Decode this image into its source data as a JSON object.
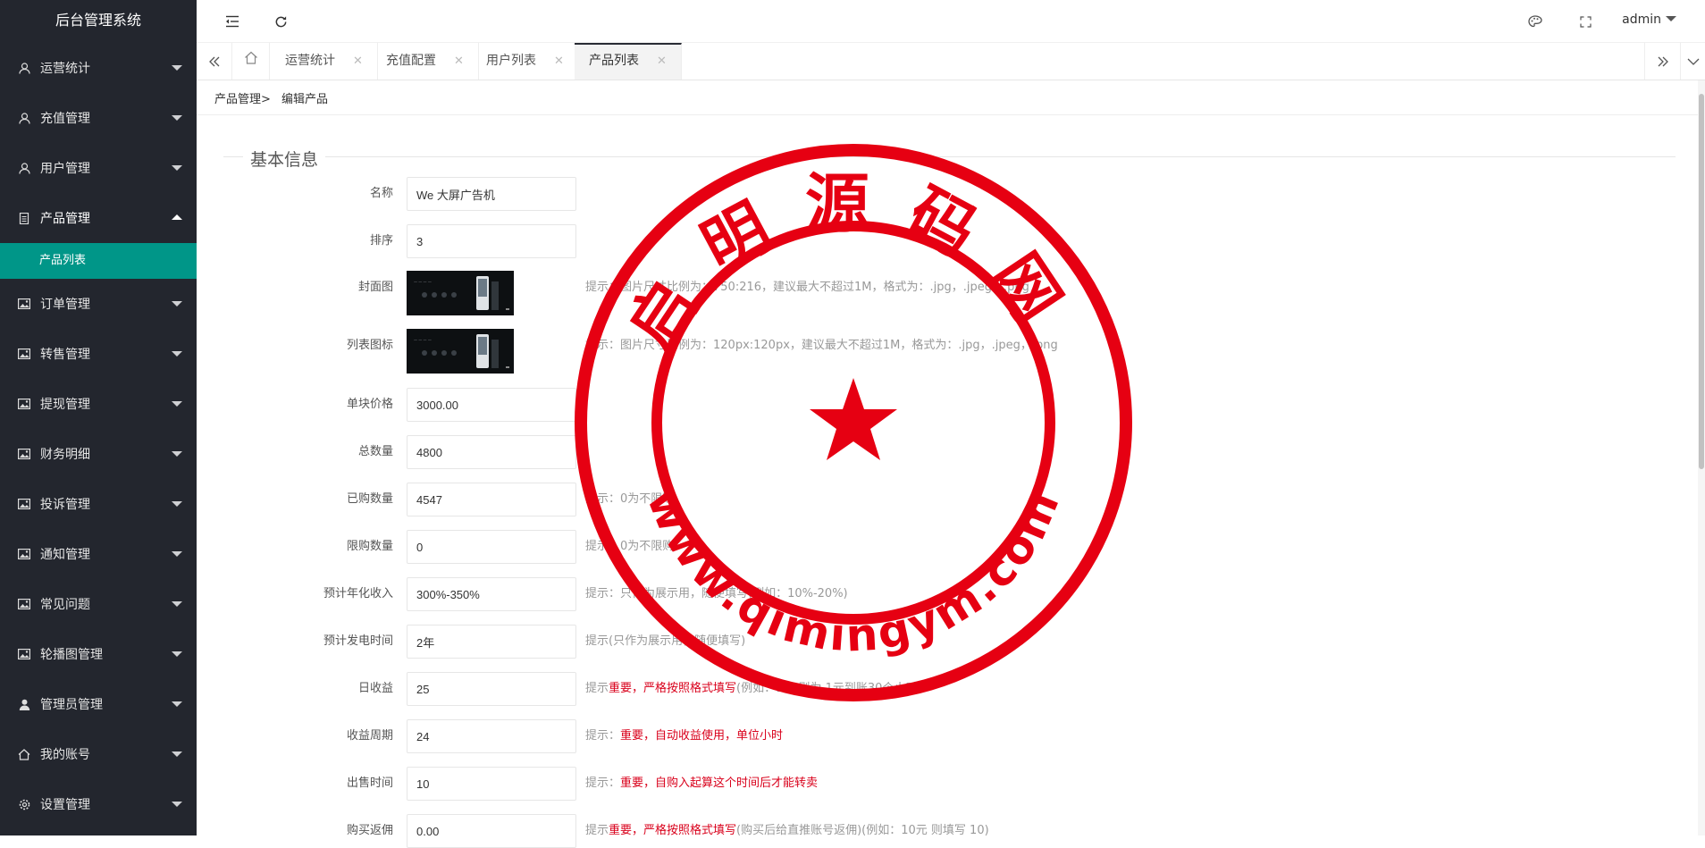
{
  "app": {
    "title": "后台管理系统"
  },
  "sidebar": {
    "items": [
      {
        "label": "运营统计",
        "icon": "user-icon"
      },
      {
        "label": "充值管理",
        "icon": "user-icon"
      },
      {
        "label": "用户管理",
        "icon": "user-icon"
      },
      {
        "label": "产品管理",
        "icon": "document-icon",
        "expanded": true,
        "children": [
          {
            "label": "产品列表",
            "active": true
          }
        ]
      },
      {
        "label": "订单管理",
        "icon": "image-icon"
      },
      {
        "label": "转售管理",
        "icon": "image-icon"
      },
      {
        "label": "提现管理",
        "icon": "image-icon"
      },
      {
        "label": "财务明细",
        "icon": "image-icon"
      },
      {
        "label": "投诉管理",
        "icon": "image-icon"
      },
      {
        "label": "通知管理",
        "icon": "image-icon"
      },
      {
        "label": "常见问题",
        "icon": "image-icon"
      },
      {
        "label": "轮播图管理",
        "icon": "image-icon"
      },
      {
        "label": "管理员管理",
        "icon": "person-icon"
      },
      {
        "label": "我的账号",
        "icon": "home-icon"
      },
      {
        "label": "设置管理",
        "icon": "gear-icon"
      }
    ]
  },
  "header": {
    "user": "admin"
  },
  "tabs": [
    {
      "label": "运营统计"
    },
    {
      "label": "充值配置"
    },
    {
      "label": "用户列表"
    },
    {
      "label": "产品列表",
      "active": true
    }
  ],
  "breadcrumb": {
    "parent": "产品管理>",
    "current": "编辑产品"
  },
  "form": {
    "legend": "基本信息",
    "fields": [
      {
        "label": "名称",
        "value": "We 大屏广告机"
      },
      {
        "label": "排序",
        "value": "3"
      },
      {
        "label": "封面图",
        "hint": "提示：图片尺寸比例为：750:216，建议最大不超过1M，格式为：.jpg，.jpeg，.png"
      },
      {
        "label": "列表图标",
        "hint": "提示：图片尺寸比例为：120px:120px，建议最大不超过1M，格式为：.jpg，.jpeg，.png"
      },
      {
        "label": "单块价格",
        "value": "3000.00"
      },
      {
        "label": "总数量",
        "value": "4800"
      },
      {
        "label": "已购数量",
        "value": "4547",
        "hint": "提示：0为不限购"
      },
      {
        "label": "限购数量",
        "value": "0",
        "hint": "提示：0为不限购"
      },
      {
        "label": "预计年化收入",
        "value": "300%-350%",
        "hint": "提示：只作为展示用，随便填写(例如：10%-20%)"
      },
      {
        "label": "预计发电时间",
        "value": "2年",
        "hint": "提示(只作为展示用，随便填写)"
      },
      {
        "label": "日收益",
        "value": "25",
        "hint_pre": "提示",
        "hint_red": "重要，严格按照格式填写",
        "hint_post": "(例如：1元 则为 1元到账30个小时)"
      },
      {
        "label": "收益周期",
        "value": "24",
        "hint_pre": "提示：",
        "hint_red": "重要，自动收益使用，单位小时",
        "hint_post": ""
      },
      {
        "label": "出售时间",
        "value": "10",
        "hint_pre": "提示：",
        "hint_red": "重要，自购入起算这个时间后才能转卖",
        "hint_post": ""
      },
      {
        "label": "购买返佣",
        "value": "0.00",
        "hint_pre": "提示",
        "hint_red": "重要，严格按照格式填写",
        "hint_post": "(购买后给直推账号返佣)(例如：10元 则填写 10)"
      }
    ]
  },
  "watermark": {
    "text": "启明源码网",
    "url": "www.qimingym.com"
  },
  "colors": {
    "sidebar_bg": "#23262e",
    "accent": "#009688",
    "stamp_red": "#e60012"
  }
}
